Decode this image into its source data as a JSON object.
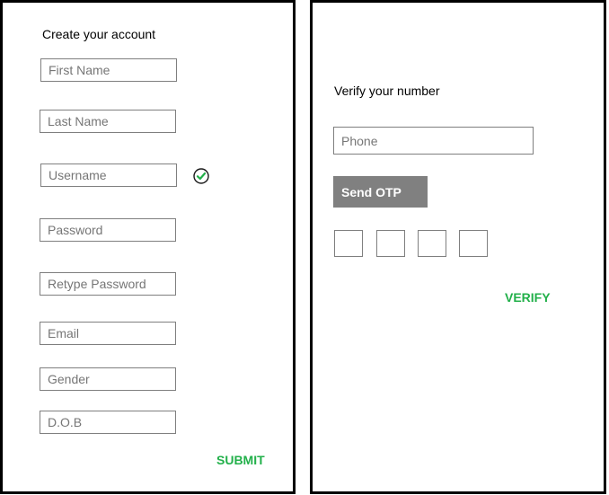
{
  "signup": {
    "title": "Create your account",
    "fields": {
      "first_name": "First Name",
      "last_name": "Last Name",
      "username": "Username",
      "password": "Password",
      "retype_password": "Retype Password",
      "email": "Email",
      "gender": "Gender",
      "dob": "D.O.B"
    },
    "username_status_icon": "check-circle-icon",
    "submit_label": "SUBMIT"
  },
  "verify": {
    "title": "Verify your number",
    "phone_placeholder": "Phone",
    "send_otp_label": "Send OTP",
    "otp_digit_count": 4,
    "verify_label": "VERIFY"
  },
  "colors": {
    "accent_green": "#22b04a",
    "button_gray": "#808080"
  }
}
